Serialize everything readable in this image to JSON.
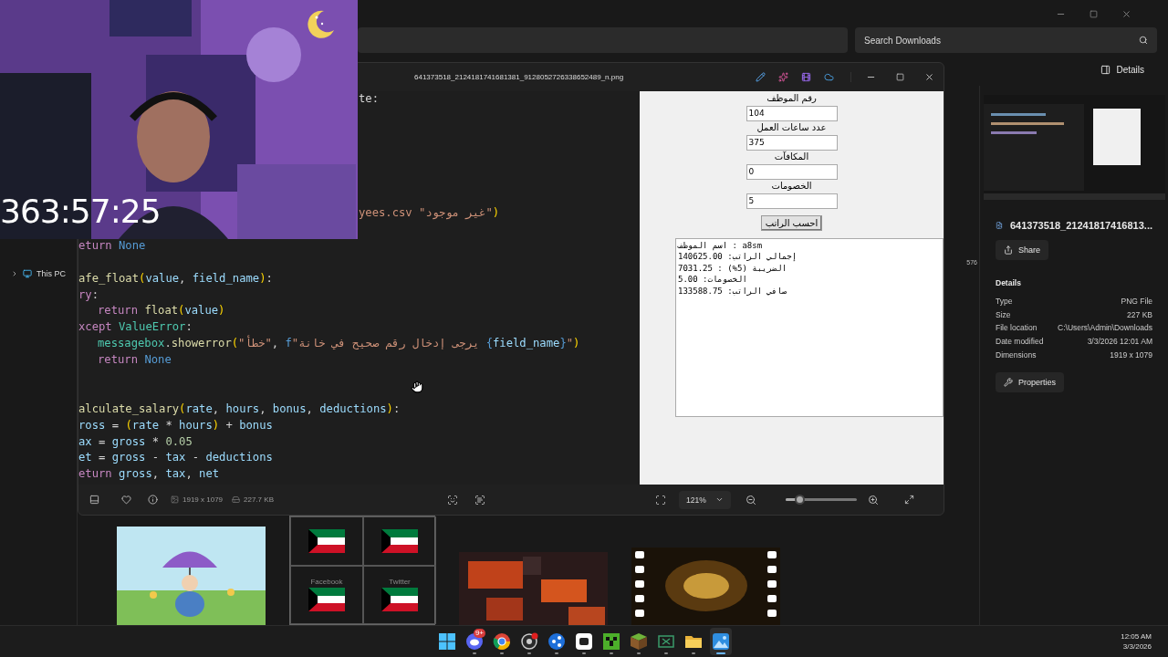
{
  "explorer": {
    "search": {
      "placeholder": "Search Downloads"
    },
    "details_button": "Details",
    "nav_items": [
      {
        "label": "This PC",
        "expanded": false
      }
    ],
    "column_text": "576",
    "gallery": [
      {
        "kind": "picture"
      },
      {
        "kind": "flags",
        "cells": [
          {
            "kind": "flag"
          },
          {
            "kind": "flag"
          },
          {
            "kind": "labeled_flag",
            "label": "Facebook"
          },
          {
            "kind": "labeled_flag",
            "label": "Twitter"
          }
        ]
      },
      {
        "kind": "picture"
      },
      {
        "kind": "video"
      }
    ],
    "details_pane": {
      "file_name": "641373518_21241817416813...",
      "share": "Share",
      "heading": "Details",
      "rows": [
        {
          "label": "Type",
          "value": "PNG File"
        },
        {
          "label": "Size",
          "value": "227 KB"
        },
        {
          "label": "File location",
          "value": "C:\\Users\\Admin\\Downloads"
        },
        {
          "label": "Date modified",
          "value": "3/3/2026 12:01 AM"
        },
        {
          "label": "Dimensions",
          "value": "1919 x 1079"
        }
      ],
      "properties": "Properties"
    }
  },
  "viewer": {
    "title": "641373518_2124181741681381_9128052726338652489_n.png",
    "code_lines": [
      {
        "kind": "clipped",
        "segments": [
          {
            "kind": "plain",
            "text": "te:"
          }
        ]
      },
      {
        "kind": "blank"
      },
      {
        "kind": "blank"
      },
      {
        "kind": "blank"
      },
      {
        "kind": "blank"
      },
      {
        "kind": "blank"
      },
      {
        "kind": "blank"
      },
      {
        "kind": "clipped",
        "segments": [
          {
            "kind": "string",
            "text": "yees.csv \"غير موجود\""
          },
          {
            "kind": "punct",
            "text": ")"
          }
        ]
      },
      {
        "kind": "blank"
      },
      {
        "kind": "code",
        "segments": [
          {
            "kind": "keyword",
            "text": "eturn "
          },
          {
            "kind": "const",
            "text": "None"
          }
        ]
      },
      {
        "kind": "blank"
      },
      {
        "kind": "code",
        "segments": [
          {
            "kind": "func",
            "text": "afe_float"
          },
          {
            "kind": "punct",
            "text": "("
          },
          {
            "kind": "name",
            "text": "value"
          },
          {
            "kind": "plain",
            "text": ", "
          },
          {
            "kind": "name",
            "text": "field_name"
          },
          {
            "kind": "punct",
            "text": ")"
          },
          {
            "kind": "plain",
            "text": ":"
          }
        ]
      },
      {
        "kind": "code",
        "segments": [
          {
            "kind": "keyword",
            "text": "ry"
          },
          {
            "kind": "plain",
            "text": ":"
          }
        ]
      },
      {
        "kind": "indented",
        "segments": [
          {
            "kind": "keyword",
            "text": "return "
          },
          {
            "kind": "func",
            "text": "float"
          },
          {
            "kind": "punct",
            "text": "("
          },
          {
            "kind": "name",
            "text": "value"
          },
          {
            "kind": "punct",
            "text": ")"
          }
        ]
      },
      {
        "kind": "code",
        "segments": [
          {
            "kind": "keyword",
            "text": "xcept "
          },
          {
            "kind": "type",
            "text": "ValueError"
          },
          {
            "kind": "plain",
            "text": ":"
          }
        ]
      },
      {
        "kind": "indented",
        "segments": [
          {
            "kind": "type",
            "text": "messagebox"
          },
          {
            "kind": "plain",
            "text": "."
          },
          {
            "kind": "func",
            "text": "showerror"
          },
          {
            "kind": "punct",
            "text": "("
          },
          {
            "kind": "string",
            "text": "\"خطأ\""
          },
          {
            "kind": "plain",
            "text": ", "
          },
          {
            "kind": "const",
            "text": "f"
          },
          {
            "kind": "string",
            "text": "\"يرجى إدخال رقم صحيح في خانة "
          },
          {
            "kind": "const",
            "text": "{"
          },
          {
            "kind": "name",
            "text": "field_name"
          },
          {
            "kind": "const",
            "text": "}"
          },
          {
            "kind": "string",
            "text": "\""
          },
          {
            "kind": "punct",
            "text": ")"
          }
        ]
      },
      {
        "kind": "indented",
        "segments": [
          {
            "kind": "keyword",
            "text": "return "
          },
          {
            "kind": "const",
            "text": "None"
          }
        ]
      },
      {
        "kind": "blank"
      },
      {
        "kind": "blank"
      },
      {
        "kind": "code",
        "segments": [
          {
            "kind": "func",
            "text": "alculate_salary"
          },
          {
            "kind": "punct",
            "text": "("
          },
          {
            "kind": "name",
            "text": "rate"
          },
          {
            "kind": "plain",
            "text": ", "
          },
          {
            "kind": "name",
            "text": "hours"
          },
          {
            "kind": "plain",
            "text": ", "
          },
          {
            "kind": "name",
            "text": "bonus"
          },
          {
            "kind": "plain",
            "text": ", "
          },
          {
            "kind": "name",
            "text": "deductions"
          },
          {
            "kind": "punct",
            "text": ")"
          },
          {
            "kind": "plain",
            "text": ":"
          }
        ]
      },
      {
        "kind": "code",
        "segments": [
          {
            "kind": "name",
            "text": "ross"
          },
          {
            "kind": "plain",
            "text": " = "
          },
          {
            "kind": "punct",
            "text": "("
          },
          {
            "kind": "name",
            "text": "rate"
          },
          {
            "kind": "plain",
            "text": " * "
          },
          {
            "kind": "name",
            "text": "hours"
          },
          {
            "kind": "punct",
            "text": ")"
          },
          {
            "kind": "plain",
            "text": " + "
          },
          {
            "kind": "name",
            "text": "bonus"
          }
        ]
      },
      {
        "kind": "code",
        "segments": [
          {
            "kind": "name",
            "text": "ax"
          },
          {
            "kind": "plain",
            "text": " = "
          },
          {
            "kind": "name",
            "text": "gross"
          },
          {
            "kind": "plain",
            "text": " * "
          },
          {
            "kind": "number",
            "text": "0.05"
          }
        ]
      },
      {
        "kind": "code",
        "segments": [
          {
            "kind": "name",
            "text": "et"
          },
          {
            "kind": "plain",
            "text": " = "
          },
          {
            "kind": "name",
            "text": "gross"
          },
          {
            "kind": "plain",
            "text": " - "
          },
          {
            "kind": "name",
            "text": "tax"
          },
          {
            "kind": "plain",
            "text": " - "
          },
          {
            "kind": "name",
            "text": "deductions"
          }
        ]
      },
      {
        "kind": "code",
        "segments": [
          {
            "kind": "keyword",
            "text": "eturn "
          },
          {
            "kind": "name",
            "text": "gross"
          },
          {
            "kind": "plain",
            "text": ", "
          },
          {
            "kind": "name",
            "text": "tax"
          },
          {
            "kind": "plain",
            "text": ", "
          },
          {
            "kind": "name",
            "text": "net"
          }
        ]
      }
    ],
    "app_form": {
      "fields": [
        {
          "label": "رقم الموظف",
          "value": "104"
        },
        {
          "label": "عدد ساعات العمل",
          "value": "375"
        },
        {
          "label": "المكافآت",
          "value": "0"
        },
        {
          "label": "الخصومات",
          "value": "5"
        }
      ],
      "button": "احسب الراتب",
      "output": [
        "اسم الموظف : a8sm",
        "140625.00 :إجمالي الراتب",
        "7031.25 : (%5) الضريبة",
        "5.00 :الخصومات",
        "133588.75 :صافي الراتب"
      ]
    },
    "toolbar": {
      "dimensions": "1919 x 1079",
      "file_size": "227.7 KB",
      "zoom": "121%",
      "zoom_slider": {
        "level": 0.19
      }
    }
  },
  "stream": {
    "timer": "363:57:25"
  },
  "taskbar": {
    "apps": [
      {
        "kind": "start",
        "running": false,
        "selected": false
      },
      {
        "kind": "chat",
        "running": true,
        "selected": false,
        "badge": "9+"
      },
      {
        "kind": "browser",
        "running": true,
        "selected": false
      },
      {
        "kind": "recorder",
        "running": true,
        "selected": false
      },
      {
        "kind": "bluecircle",
        "running": true,
        "selected": false
      },
      {
        "kind": "whitesquare",
        "running": true,
        "selected": false
      },
      {
        "kind": "creeper",
        "running": true,
        "selected": false
      },
      {
        "kind": "block",
        "running": true,
        "selected": false
      },
      {
        "kind": "sheet",
        "running": true,
        "selected": false
      },
      {
        "kind": "folder",
        "running": true,
        "selected": false
      },
      {
        "kind": "photos",
        "running": true,
        "selected": true
      }
    ],
    "time": "12:05 AM",
    "date": "3/3/2026"
  }
}
